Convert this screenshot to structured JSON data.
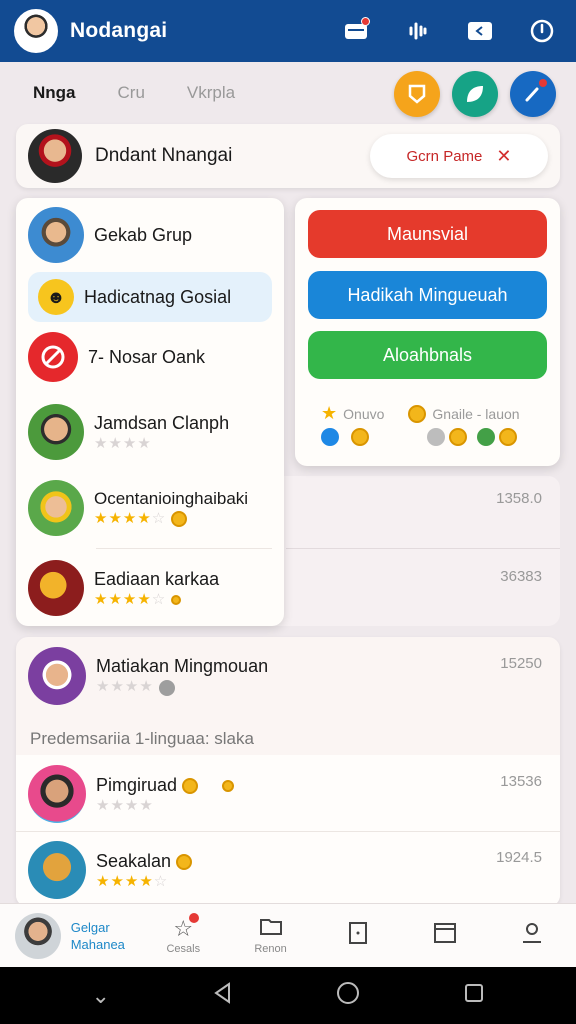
{
  "app": {
    "title": "Nodangai"
  },
  "appbar_icons": [
    "mail-icon",
    "sound-icon",
    "message-icon",
    "timer-icon"
  ],
  "tabs": [
    {
      "label": "Nnga",
      "active": true
    },
    {
      "label": "Cru",
      "active": false
    },
    {
      "label": "Vkrpla",
      "active": false
    }
  ],
  "quick_actions": [
    {
      "icon": "award-icon",
      "color": "#f5a41b"
    },
    {
      "icon": "leaf-icon",
      "color": "#16a386"
    },
    {
      "icon": "phone-icon",
      "color": "#1769c2"
    }
  ],
  "profile": {
    "name": "Dndant Nnangai",
    "pill_label": "Gcrn Pame"
  },
  "left_menu": {
    "items": [
      {
        "label": "Gekab Grup"
      },
      {
        "label": "Hadicatnag Gosial",
        "highlighted": true
      },
      {
        "label": "7- Nosar Oank"
      },
      {
        "label": "Jamdsan Clanph",
        "rating": 0
      },
      {
        "label": "Ocentanioinghaibaki",
        "rating": 4
      },
      {
        "label": "Eadiaan karkaa",
        "rating": 4
      }
    ]
  },
  "right_menu": {
    "buttons": [
      {
        "label": "Maunsvial",
        "color": "#e53a2c"
      },
      {
        "label": "Hadikah Mingueuah",
        "color": "#1a86d8"
      },
      {
        "label": "Aloahbnals",
        "color": "#33b64a"
      }
    ],
    "mini_left": "Onuvo",
    "mini_right": "Gnaile - lauon"
  },
  "list_numbers": [
    "1358.0",
    "36383"
  ],
  "lower": {
    "top_row": {
      "name": "Matiakan Mingmouan",
      "value": "15250",
      "rating": 0
    },
    "section_label": "Predemsariia 1-linguaa: slaka",
    "rows": [
      {
        "name": "Pimgiruad",
        "value": "13536",
        "rating": 0
      },
      {
        "name": "Seakalan",
        "value": "1924.5",
        "rating": 4
      }
    ]
  },
  "bottom_nav": {
    "profile_line1": "Gelgar",
    "profile_line2": "Mahanea",
    "items": [
      {
        "label": "Cesals",
        "icon": "star-icon"
      },
      {
        "label": "Renon",
        "icon": "folder-icon"
      },
      {
        "label": "",
        "icon": "book-icon"
      },
      {
        "label": "",
        "icon": "window-icon"
      },
      {
        "label": "",
        "icon": "person-icon"
      }
    ]
  }
}
